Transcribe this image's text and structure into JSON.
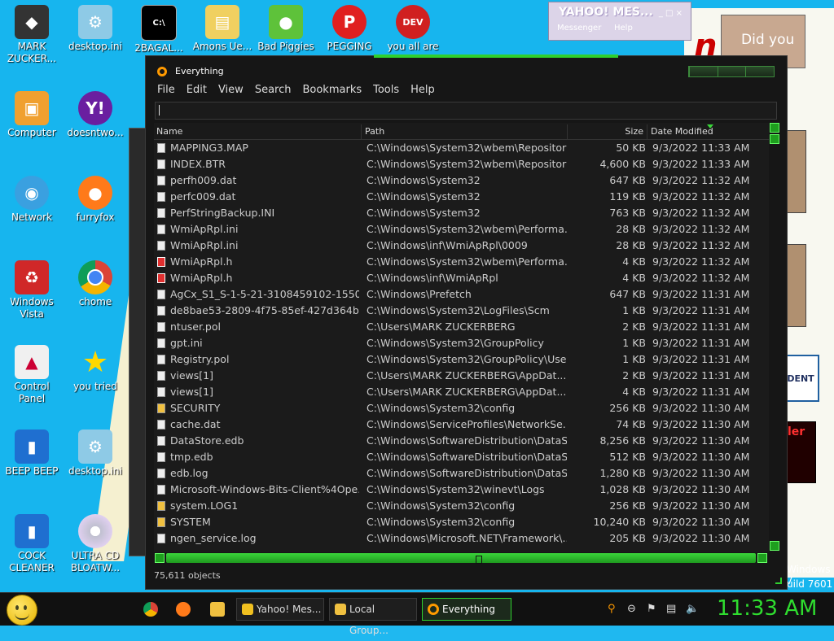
{
  "desktop_icons": [
    {
      "label": "MARK ZUCKER...",
      "icon": "user-folder-icon"
    },
    {
      "label": "desktop.ini",
      "icon": "settings-file-icon"
    },
    {
      "label": "2BAGAL...",
      "icon": "cmd-icon"
    },
    {
      "label": "Amons Ue...",
      "icon": "folder-icon"
    },
    {
      "label": "Bad Piggies",
      "icon": "pig-icon"
    },
    {
      "label": "PEGGING",
      "icon": "p-app-icon"
    },
    {
      "label": "you all are",
      "icon": "devcpp-icon"
    },
    {
      "label": "Computer",
      "icon": "computer-icon"
    },
    {
      "label": "doesntwo...",
      "icon": "yahoo-icon"
    },
    {
      "label": "Network",
      "icon": "network-icon"
    },
    {
      "label": "furryfox",
      "icon": "firefox-icon"
    },
    {
      "label": "Windows Vista",
      "icon": "recycle-bin-icon"
    },
    {
      "label": "chome",
      "icon": "chrome-icon"
    },
    {
      "label": "Control Panel",
      "icon": "control-panel-icon"
    },
    {
      "label": "you tried",
      "icon": "star-icon"
    },
    {
      "label": "BEEP BEEP",
      "icon": "book-icon"
    },
    {
      "label": "desktop.ini",
      "icon": "settings-file-icon"
    },
    {
      "label": "COCK CLEANER",
      "icon": "book-icon"
    },
    {
      "label": "ULTRA CD BLOATW...",
      "icon": "cd-icon"
    }
  ],
  "background_text": {
    "did_you": "Did you",
    "dent": "DENT",
    "ler": "ler",
    "windows7": "Windows 7",
    "build": "uild 7601",
    "red_letters": "n t"
  },
  "yahoo": {
    "title": "YAHOO! MES...",
    "messenger": "Messenger",
    "help": "Help",
    "controls": "_ □ ×"
  },
  "everything": {
    "title": "Everything",
    "menu": [
      "File",
      "Edit",
      "View",
      "Search",
      "Bookmarks",
      "Tools",
      "Help"
    ],
    "search_value": "",
    "columns": {
      "name": "Name",
      "path": "Path",
      "size": "Size",
      "date": "Date Modified"
    },
    "rows": [
      {
        "name": "MAPPING3.MAP",
        "path": "C:\\Windows\\System32\\wbem\\Repository",
        "size": "50 KB",
        "date": "9/3/2022 11:33 AM",
        "icon": "file-icon"
      },
      {
        "name": "INDEX.BTR",
        "path": "C:\\Windows\\System32\\wbem\\Repository",
        "size": "4,600 KB",
        "date": "9/3/2022 11:33 AM",
        "icon": "file-icon"
      },
      {
        "name": "perfh009.dat",
        "path": "C:\\Windows\\System32",
        "size": "647 KB",
        "date": "9/3/2022 11:32 AM",
        "icon": "file-icon"
      },
      {
        "name": "perfc009.dat",
        "path": "C:\\Windows\\System32",
        "size": "119 KB",
        "date": "9/3/2022 11:32 AM",
        "icon": "file-icon"
      },
      {
        "name": "PerfStringBackup.INI",
        "path": "C:\\Windows\\System32",
        "size": "763 KB",
        "date": "9/3/2022 11:32 AM",
        "icon": "settings-file-icon"
      },
      {
        "name": "WmiApRpl.ini",
        "path": "C:\\Windows\\System32\\wbem\\Performa...",
        "size": "28 KB",
        "date": "9/3/2022 11:32 AM",
        "icon": "settings-file-icon"
      },
      {
        "name": "WmiApRpl.ini",
        "path": "C:\\Windows\\inf\\WmiApRpl\\0009",
        "size": "28 KB",
        "date": "9/3/2022 11:32 AM",
        "icon": "settings-file-icon"
      },
      {
        "name": "WmiApRpl.h",
        "path": "C:\\Windows\\System32\\wbem\\Performa...",
        "size": "4 KB",
        "date": "9/3/2022 11:32 AM",
        "icon": "header-file-icon"
      },
      {
        "name": "WmiApRpl.h",
        "path": "C:\\Windows\\inf\\WmiApRpl",
        "size": "4 KB",
        "date": "9/3/2022 11:32 AM",
        "icon": "header-file-icon"
      },
      {
        "name": "AgCx_S1_S-1-5-21-3108459102-1550...",
        "path": "C:\\Windows\\Prefetch",
        "size": "647 KB",
        "date": "9/3/2022 11:31 AM",
        "icon": "settings-file-icon"
      },
      {
        "name": "de8bae53-2809-4f75-85ef-427d364b9...",
        "path": "C:\\Windows\\System32\\LogFiles\\Scm",
        "size": "1 KB",
        "date": "9/3/2022 11:31 AM",
        "icon": "file-icon"
      },
      {
        "name": "ntuser.pol",
        "path": "C:\\Users\\MARK ZUCKERBERG",
        "size": "2 KB",
        "date": "9/3/2022 11:31 AM",
        "icon": "file-icon"
      },
      {
        "name": "gpt.ini",
        "path": "C:\\Windows\\System32\\GroupPolicy",
        "size": "1 KB",
        "date": "9/3/2022 11:31 AM",
        "icon": "settings-file-icon"
      },
      {
        "name": "Registry.pol",
        "path": "C:\\Windows\\System32\\GroupPolicy\\User",
        "size": "1 KB",
        "date": "9/3/2022 11:31 AM",
        "icon": "file-icon"
      },
      {
        "name": "views[1]",
        "path": "C:\\Users\\MARK ZUCKERBERG\\AppDat...",
        "size": "2 KB",
        "date": "9/3/2022 11:31 AM",
        "icon": "file-icon"
      },
      {
        "name": "views[1]",
        "path": "C:\\Users\\MARK ZUCKERBERG\\AppDat...",
        "size": "4 KB",
        "date": "9/3/2022 11:31 AM",
        "icon": "file-icon"
      },
      {
        "name": "SECURITY",
        "path": "C:\\Windows\\System32\\config",
        "size": "256 KB",
        "date": "9/3/2022 11:30 AM",
        "icon": "locked-file-icon"
      },
      {
        "name": "cache.dat",
        "path": "C:\\Windows\\ServiceProfiles\\NetworkSe...",
        "size": "74 KB",
        "date": "9/3/2022 11:30 AM",
        "icon": "file-icon"
      },
      {
        "name": "DataStore.edb",
        "path": "C:\\Windows\\SoftwareDistribution\\DataSt...",
        "size": "8,256 KB",
        "date": "9/3/2022 11:30 AM",
        "icon": "file-icon"
      },
      {
        "name": "tmp.edb",
        "path": "C:\\Windows\\SoftwareDistribution\\DataSt...",
        "size": "512 KB",
        "date": "9/3/2022 11:30 AM",
        "icon": "file-icon"
      },
      {
        "name": "edb.log",
        "path": "C:\\Windows\\SoftwareDistribution\\DataSt...",
        "size": "1,280 KB",
        "date": "9/3/2022 11:30 AM",
        "icon": "file-icon"
      },
      {
        "name": "Microsoft-Windows-Bits-Client%4Ope...",
        "path": "C:\\Windows\\System32\\winevt\\Logs",
        "size": "1,028 KB",
        "date": "9/3/2022 11:30 AM",
        "icon": "event-log-icon"
      },
      {
        "name": "system.LOG1",
        "path": "C:\\Windows\\System32\\config",
        "size": "256 KB",
        "date": "9/3/2022 11:30 AM",
        "icon": "locked-file-icon"
      },
      {
        "name": "SYSTEM",
        "path": "C:\\Windows\\System32\\config",
        "size": "10,240 KB",
        "date": "9/3/2022 11:30 AM",
        "icon": "locked-file-icon"
      },
      {
        "name": "ngen_service.log",
        "path": "C:\\Windows\\Microsoft.NET\\Framework\\...",
        "size": "205 KB",
        "date": "9/3/2022 11:30 AM",
        "icon": "file-icon"
      }
    ],
    "status": "75,611 objects",
    "accent": "#2fd02f"
  },
  "taskbar": {
    "tasks": [
      {
        "label": "Yahoo! Mes...",
        "icon": "yahoo-icon"
      },
      {
        "label": "Local Group...",
        "icon": "group-policy-icon"
      },
      {
        "label": "Everything",
        "icon": "everything-icon"
      }
    ],
    "clock": "11:33 AM",
    "tray_icons": [
      "search-icon",
      "minus-icon",
      "flag-icon",
      "network-icon",
      "volume-icon"
    ]
  }
}
